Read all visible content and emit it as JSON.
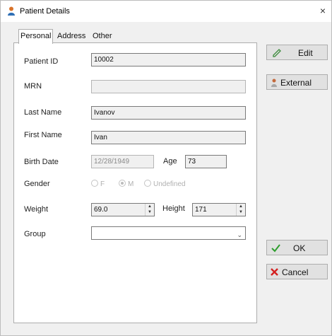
{
  "window": {
    "title": "Patient Details",
    "close_glyph": "×"
  },
  "tabs": [
    {
      "label": "Personal",
      "active": true
    },
    {
      "label": "Address",
      "active": false
    },
    {
      "label": "Other",
      "active": false
    }
  ],
  "form": {
    "patient_id_label": "Patient ID",
    "patient_id_value": "10002",
    "mrn_label": "MRN",
    "mrn_value": "",
    "last_name_label": "Last Name",
    "last_name_value": "Ivanov",
    "first_name_label": "First Name",
    "first_name_value": "Ivan",
    "birth_date_label": "Birth Date",
    "birth_date_value": "12/28/1949",
    "age_label": "Age",
    "age_value": "73",
    "gender_label": "Gender",
    "gender_options": [
      "F",
      "M",
      "Undefined"
    ],
    "gender_selected": "M",
    "weight_label": "Weight",
    "weight_value": "69.0",
    "height_label": "Height",
    "height_value": "171",
    "group_label": "Group",
    "group_value": ""
  },
  "buttons": {
    "edit": "Edit",
    "external": "External",
    "ok": "OK",
    "cancel": "Cancel"
  },
  "icons": {
    "title": "patient-app-icon",
    "edit": "pencil-icon",
    "external": "person-icon",
    "ok": "checkmark-icon",
    "cancel": "x-icon"
  },
  "colors": {
    "ok_icon": "#2e9e2e",
    "cancel_icon": "#d42020",
    "edit_icon": "#3a8a3a"
  }
}
